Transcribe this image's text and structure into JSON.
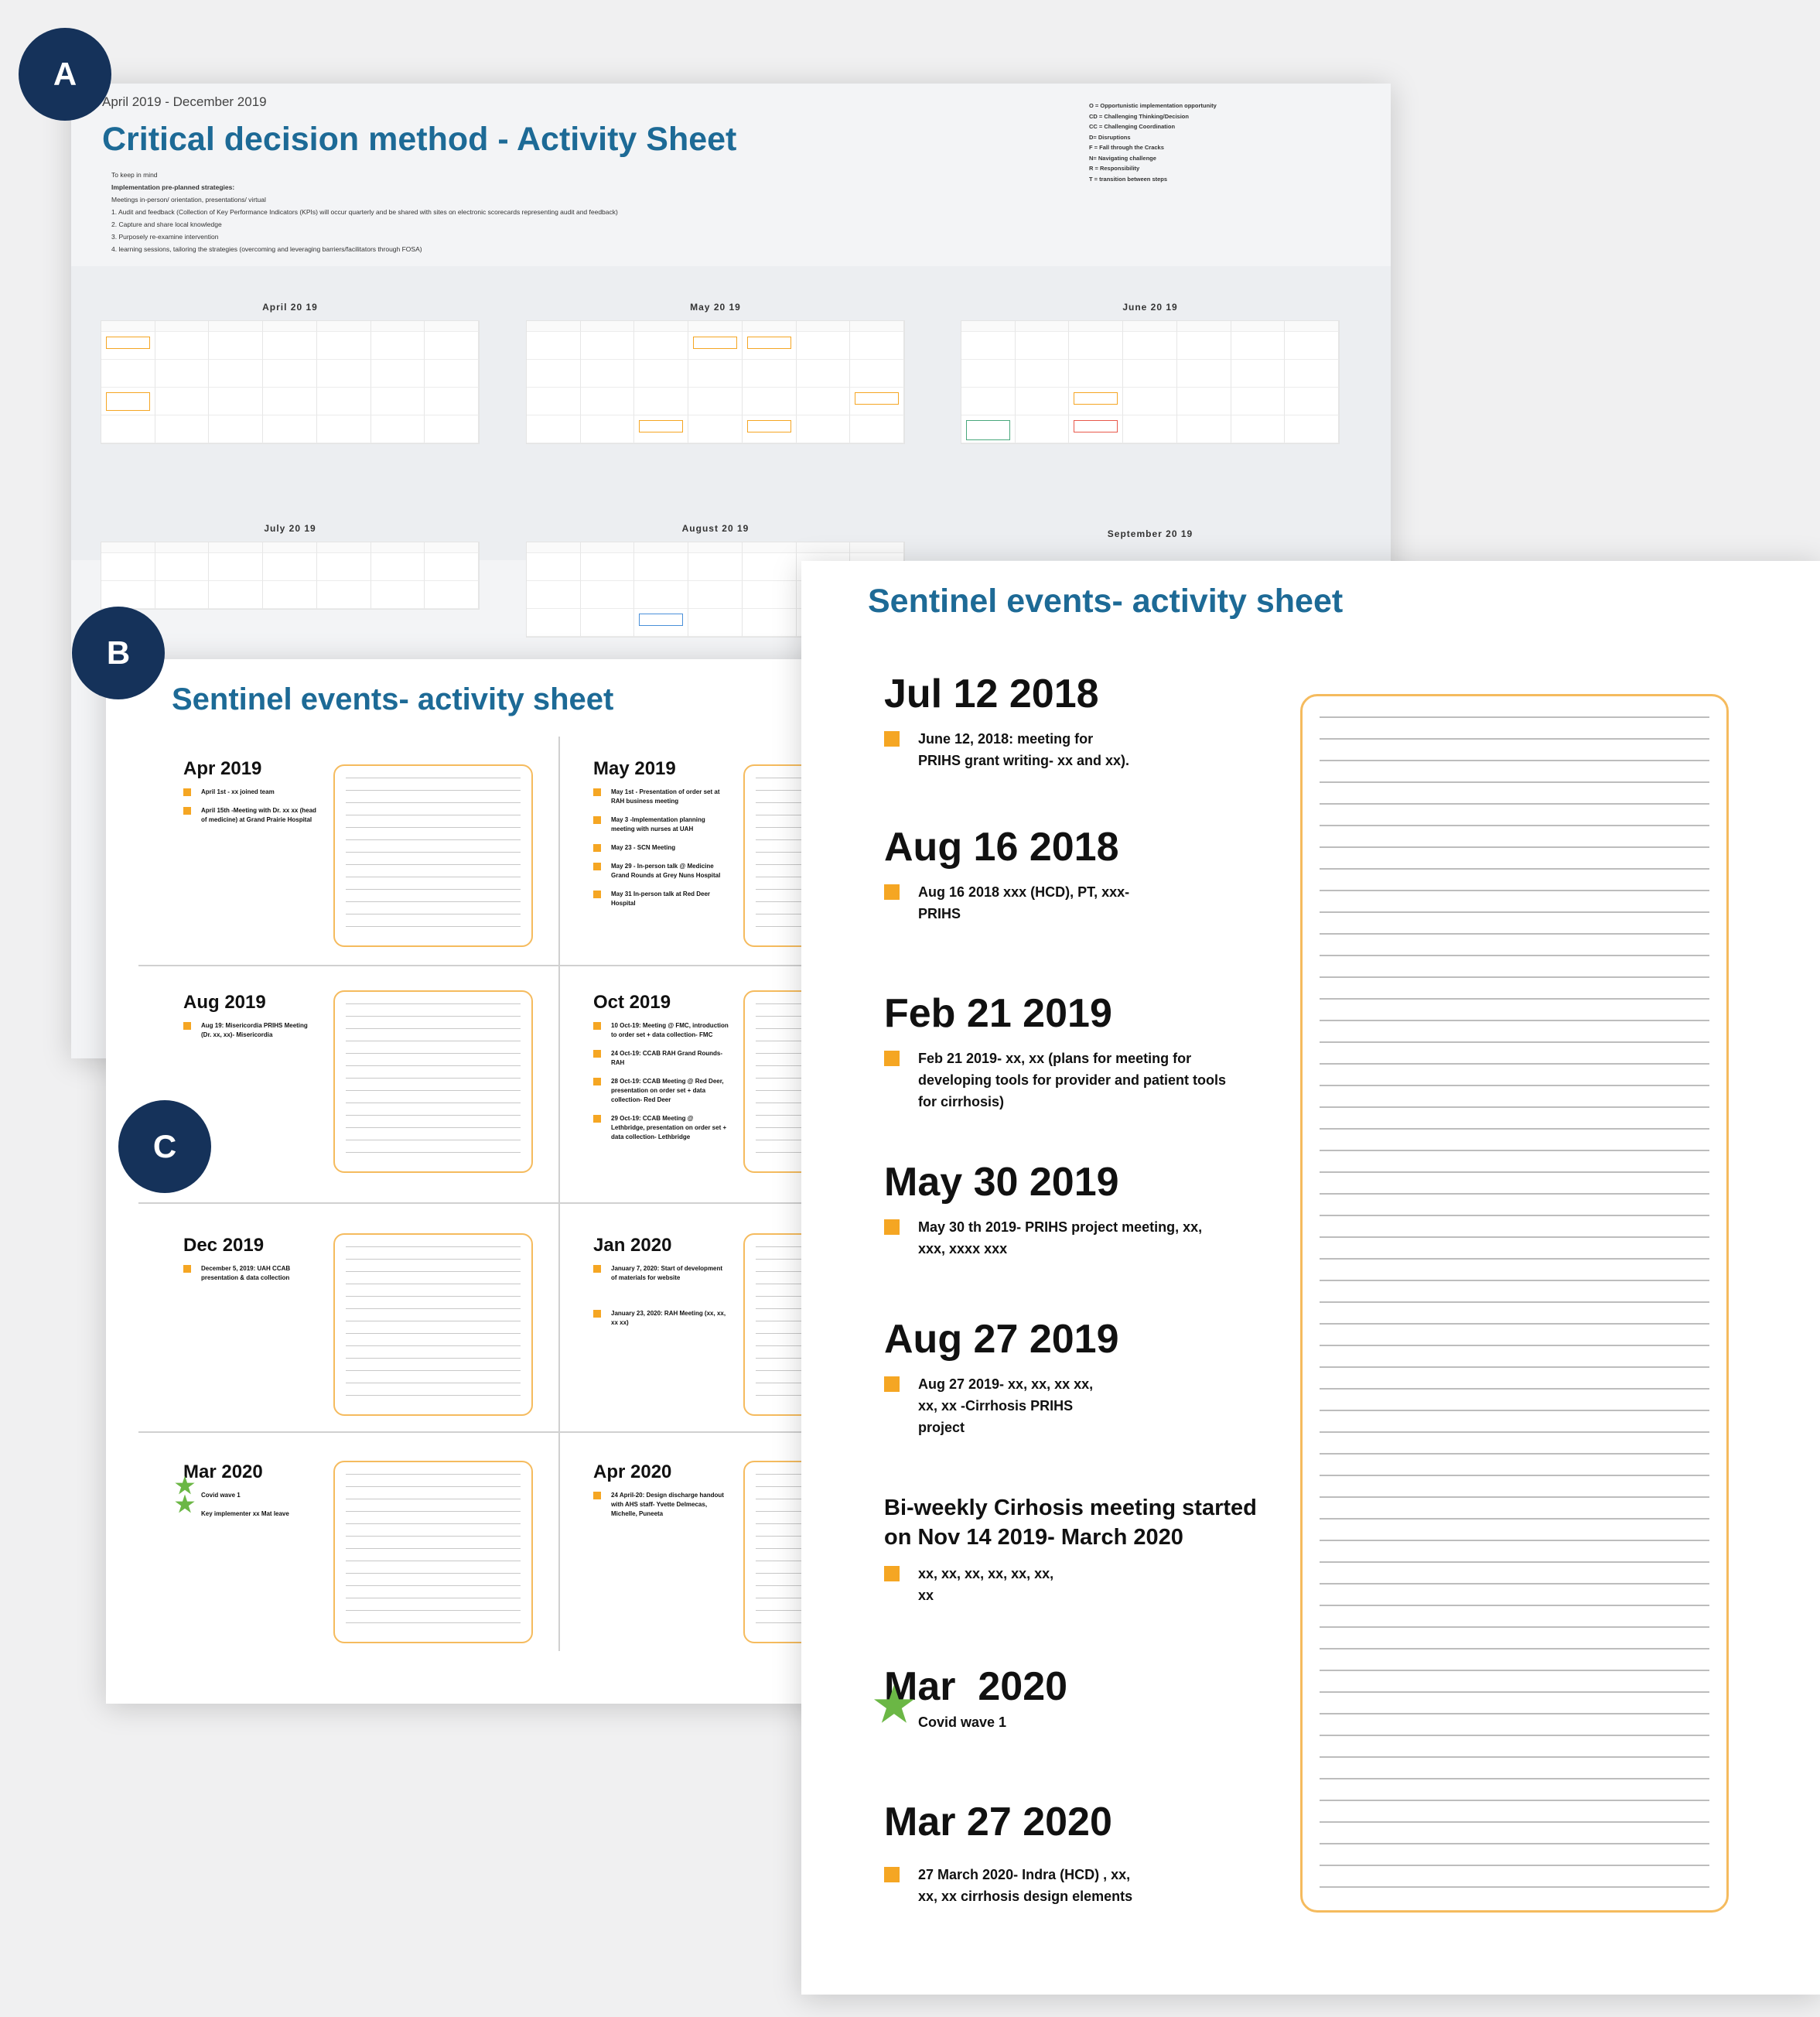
{
  "badges": {
    "a": "A",
    "b": "B",
    "c": "C"
  },
  "sheet_a": {
    "date_range": "April 2019 - December 2019",
    "title": "Critical decision method - Activity Sheet",
    "notes": [
      "To keep in mind",
      "Implementation pre-planned strategies:",
      "Meetings in-person/ orientation, presentations/ virtual",
      "1. Audit and feedback (Collection of Key Performance Indicators (KPIs) will occur quarterly and be shared with sites on electronic scorecards representing audit and feedback)",
      "2. Capture and share local knowledge",
      "3. Purposely re-examine intervention",
      "4. learning sessions, tailoring the strategies (overcoming and leveraging barriers/facilitators through FOSA)"
    ],
    "legend": [
      "O = Opportunistic implementation opportunity",
      "CD = Challenging Thinking/Decision",
      "CC = Challenging Coordination",
      "D= Disruptions",
      "F = Fall through the Cracks",
      "N= Navigating challenge",
      "R = Responsibility",
      "T = transition between steps"
    ],
    "months": [
      "April 20 19",
      "May 20 19",
      "June 20 19",
      "July 20 19",
      "August 20 19",
      "September 20 19"
    ]
  },
  "sheet_b": {
    "title": "Sentinel events- activity sheet",
    "quadrants": [
      {
        "month": "Apr 2019",
        "items": [
          "April 1st - xx joined team",
          "April 15th -Meeting with Dr. xx xx (head of medicine) at Grand Prairie Hospital"
        ]
      },
      {
        "month": "May 2019",
        "items": [
          "May 1st - Presentation of order set at RAH business meeting",
          "May 3 -Implementation planning meeting with nurses at UAH",
          "May 23 - SCN Meeting",
          "May 29 - In-person talk @ Medicine Grand Rounds at Grey Nuns Hospital",
          "May 31 In-person talk at Red Deer Hospital"
        ]
      },
      {
        "month": "Aug 2019",
        "items": [
          "Aug 19: Misericordia PRIHS Meeting (Dr. xx, xx)- Misericordia"
        ]
      },
      {
        "month": "Oct 2019",
        "items": [
          "10 Oct-19: Meeting @ FMC, introduction to order set + data collection- FMC",
          "24 Oct-19: CCAB RAH Grand Rounds- RAH",
          "28 Oct-19: CCAB Meeting @ Red Deer, presentation on order set + data collection- Red Deer",
          "29 Oct-19: CCAB Meeting @ Lethbridge, presentation on order set + data collection- Lethbridge"
        ]
      },
      {
        "month": "Dec 2019",
        "items": [
          "December 5, 2019: UAH CCAB presentation & data collection"
        ]
      },
      {
        "month": "Jan 2020",
        "items": [
          "January 7, 2020: Start of development of materials for website",
          "January 23, 2020: RAH Meeting (xx, xx, xx xx)"
        ]
      },
      {
        "month": "Mar 2020",
        "items": [
          "Covid wave 1",
          "Key implementer xx Mat leave"
        ]
      },
      {
        "month": "Apr 2020",
        "items": [
          "24 April-20: Design discharge handout with AHS staff- Yvette Delmecas, Michelle, Puneeta"
        ]
      }
    ]
  },
  "sheet_c": {
    "title": "Sentinel events- activity sheet",
    "entries": [
      {
        "heading": "Jul 12 2018",
        "text": "June 12, 2018: meeting for PRIHS grant writing- xx and xx)."
      },
      {
        "heading": "Aug 16 2018",
        "text": "Aug 16 2018 xxx (HCD), PT, xxx- PRIHS"
      },
      {
        "heading": "Feb 21 2019",
        "text": "Feb 21 2019- xx, xx (plans for meeting for developing tools for provider and patient tools for cirrhosis)"
      },
      {
        "heading": "May 30 2019",
        "text": "May 30 th 2019- PRIHS project meeting, xx, xxx, xxxx xxx"
      },
      {
        "heading": "Aug 27 2019",
        "text": "Aug 27 2019- xx, xx, xx xx, xx, xx -Cirrhosis PRIHS project"
      },
      {
        "heading": "Bi-weekly Cirhosis meeting started on Nov 14 2019- March 2020",
        "text": "xx, xx, xx, xx, xx, xx, xx"
      },
      {
        "heading": "Mar  2020",
        "text": "Covid wave 1"
      },
      {
        "heading": "Mar 27 2020",
        "text": "27 March 2020- Indra (HCD) , xx, xx, xx cirrhosis design elements"
      }
    ]
  },
  "colors": {
    "title_blue": "#1d6a96",
    "badge_navy": "#15325a",
    "bullet_orange": "#f5a623",
    "star_green": "#6bb745"
  }
}
